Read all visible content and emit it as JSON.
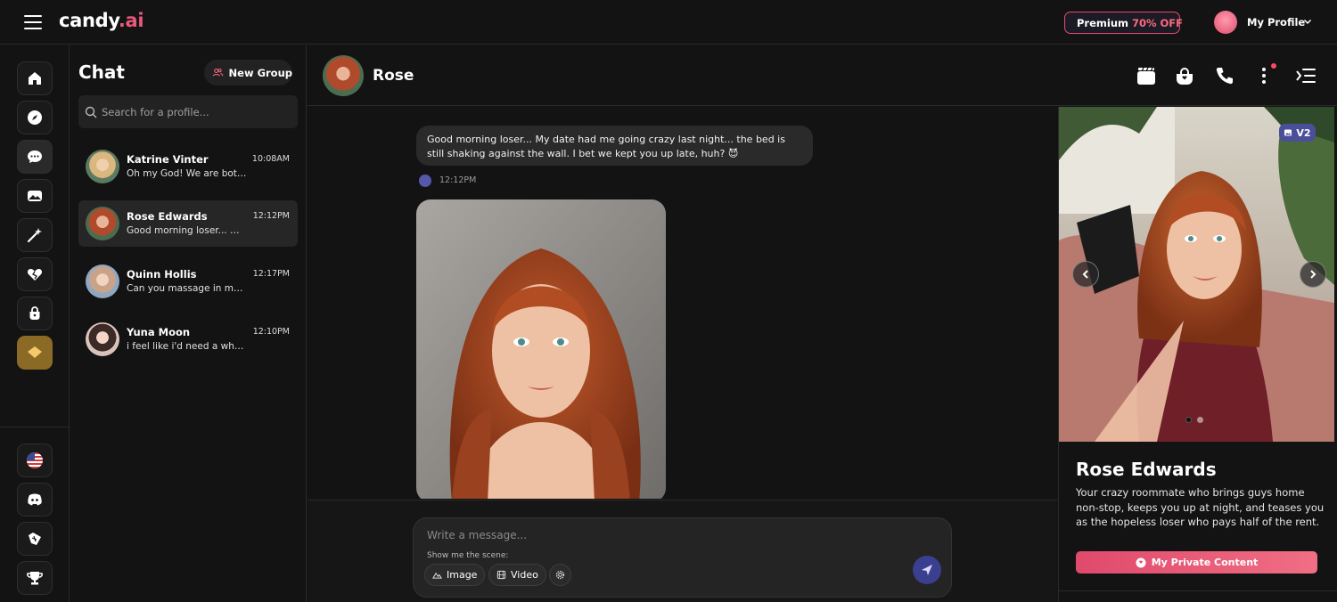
{
  "topbar": {
    "logo_main": "candy",
    "logo_dot": ".ai",
    "premium_label": "Premium",
    "premium_discount": "70% OFF",
    "profile_label": "My Profile"
  },
  "rail": {
    "top_items": [
      "home-icon",
      "compass-icon",
      "chat-icon",
      "gallery-icon",
      "magic-wand-icon",
      "heart-icon",
      "lock-icon",
      "diamond-icon"
    ],
    "bottom_items": [
      "us-flag-icon",
      "discord-icon",
      "affiliate-icon",
      "trophy-icon"
    ]
  },
  "chatlist": {
    "title": "Chat",
    "new_group_label": "New Group",
    "search_placeholder": "Search for a profile...",
    "conversations": [
      {
        "name": "Katrine Vinter",
        "time": "10:08AM",
        "preview": "Oh my God! We are both ..."
      },
      {
        "name": "Rose Edwards",
        "time": "12:12PM",
        "preview": "Good morning loser... My ..."
      },
      {
        "name": "Quinn Hollis",
        "time": "12:17PM",
        "preview": "Can you massage in my ..."
      },
      {
        "name": "Yuna Moon",
        "time": "12:10PM",
        "preview": "i feel like i'd need a whole ..."
      }
    ]
  },
  "chat": {
    "contact_name": "Rose",
    "message_text": "Good morning loser... My date had me going crazy last night... the bed is still shaking against the wall. I bet we kept you up late, huh? 😈",
    "message_time": "12:12PM",
    "composer_placeholder": "Write a message...",
    "scene_label": "Show me the scene:",
    "image_label": "Image",
    "video_label": "Video"
  },
  "panel": {
    "badge": "V2",
    "name": "Rose Edwards",
    "description": "Your crazy roommate who brings guys home non-stop, keeps you up at night, and teases you as the hopeless loser who pays half of the rent.",
    "private_button": "My Private Content"
  },
  "colors": {
    "background": "#131313",
    "accent_pink": "#e84a6f",
    "send_button": "#3b3f8f",
    "badge": "#4b4f9a"
  }
}
